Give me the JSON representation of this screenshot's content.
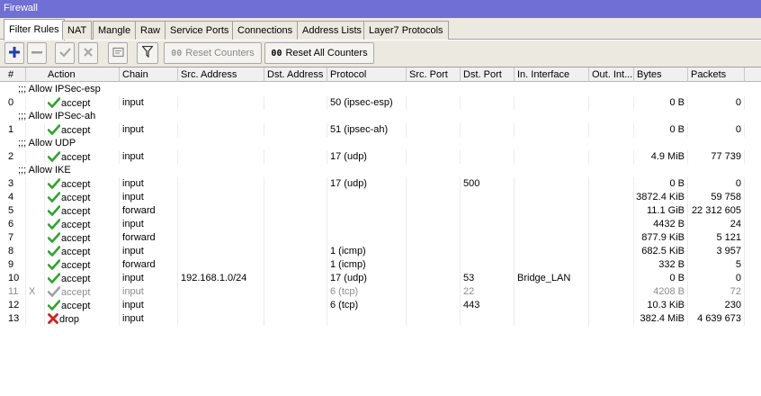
{
  "window": {
    "title": "Firewall"
  },
  "tabs": [
    "Filter Rules",
    "NAT",
    "Mangle",
    "Raw",
    "Service Ports",
    "Connections",
    "Address Lists",
    "Layer7 Protocols"
  ],
  "toolbar": {
    "reset_counters_icon": "00",
    "reset_counters": "Reset Counters",
    "reset_all_icon": "00",
    "reset_all": "Reset All Counters"
  },
  "columns": [
    "#",
    "Action",
    "Chain",
    "Src. Address",
    "Dst. Address",
    "Protocol",
    "Src. Port",
    "Dst. Port",
    "In. Interface",
    "Out. Int...",
    "Bytes",
    "Packets"
  ],
  "rows": [
    {
      "type": "comment",
      "text": ";;; Allow IPSec-esp"
    },
    {
      "type": "rule",
      "num": "0",
      "flag": "",
      "action": "accept",
      "icon": "check",
      "chain": "input",
      "src": "",
      "dst": "",
      "protocol": "50 (ipsec-esp)",
      "sport": "",
      "dport": "",
      "inif": "",
      "outif": "",
      "bytes": "0 B",
      "packets": "0"
    },
    {
      "type": "comment",
      "text": ";;; Allow IPSec-ah"
    },
    {
      "type": "rule",
      "num": "1",
      "flag": "",
      "action": "accept",
      "icon": "check",
      "chain": "input",
      "src": "",
      "dst": "",
      "protocol": "51 (ipsec-ah)",
      "sport": "",
      "dport": "",
      "inif": "",
      "outif": "",
      "bytes": "0 B",
      "packets": "0"
    },
    {
      "type": "comment",
      "text": ";;; Allow UDP"
    },
    {
      "type": "rule",
      "num": "2",
      "flag": "",
      "action": "accept",
      "icon": "check",
      "chain": "input",
      "src": "",
      "dst": "",
      "protocol": "17 (udp)",
      "sport": "",
      "dport": "",
      "inif": "",
      "outif": "",
      "bytes": "4.9 MiB",
      "packets": "77 739"
    },
    {
      "type": "comment",
      "text": ";;; Allow IKE"
    },
    {
      "type": "rule",
      "num": "3",
      "flag": "",
      "action": "accept",
      "icon": "check",
      "chain": "input",
      "src": "",
      "dst": "",
      "protocol": "17 (udp)",
      "sport": "",
      "dport": "500",
      "inif": "",
      "outif": "",
      "bytes": "0 B",
      "packets": "0"
    },
    {
      "type": "rule",
      "num": "4",
      "flag": "",
      "action": "accept",
      "icon": "check",
      "chain": "input",
      "src": "",
      "dst": "",
      "protocol": "",
      "sport": "",
      "dport": "",
      "inif": "",
      "outif": "",
      "bytes": "3872.4 KiB",
      "packets": "59 758"
    },
    {
      "type": "rule",
      "num": "5",
      "flag": "",
      "action": "accept",
      "icon": "check",
      "chain": "forward",
      "src": "",
      "dst": "",
      "protocol": "",
      "sport": "",
      "dport": "",
      "inif": "",
      "outif": "",
      "bytes": "11.1 GiB",
      "packets": "22 312 605"
    },
    {
      "type": "rule",
      "num": "6",
      "flag": "",
      "action": "accept",
      "icon": "check",
      "chain": "input",
      "src": "",
      "dst": "",
      "protocol": "",
      "sport": "",
      "dport": "",
      "inif": "",
      "outif": "",
      "bytes": "4432 B",
      "packets": "24"
    },
    {
      "type": "rule",
      "num": "7",
      "flag": "",
      "action": "accept",
      "icon": "check",
      "chain": "forward",
      "src": "",
      "dst": "",
      "protocol": "",
      "sport": "",
      "dport": "",
      "inif": "",
      "outif": "",
      "bytes": "877.9 KiB",
      "packets": "5 121"
    },
    {
      "type": "rule",
      "num": "8",
      "flag": "",
      "action": "accept",
      "icon": "check",
      "chain": "input",
      "src": "",
      "dst": "",
      "protocol": "1 (icmp)",
      "sport": "",
      "dport": "",
      "inif": "",
      "outif": "",
      "bytes": "682.5 KiB",
      "packets": "3 957"
    },
    {
      "type": "rule",
      "num": "9",
      "flag": "",
      "action": "accept",
      "icon": "check",
      "chain": "forward",
      "src": "",
      "dst": "",
      "protocol": "1 (icmp)",
      "sport": "",
      "dport": "",
      "inif": "",
      "outif": "",
      "bytes": "332 B",
      "packets": "5"
    },
    {
      "type": "rule",
      "num": "10",
      "flag": "",
      "action": "accept",
      "icon": "check",
      "chain": "input",
      "src": "192.168.1.0/24",
      "dst": "",
      "protocol": "17 (udp)",
      "sport": "",
      "dport": "53",
      "inif": "Bridge_LAN",
      "outif": "",
      "bytes": "0 B",
      "packets": "0"
    },
    {
      "type": "rule",
      "num": "11",
      "flag": "X",
      "disabled": true,
      "action": "accept",
      "icon": "check",
      "chain": "input",
      "src": "",
      "dst": "",
      "protocol": "6 (tcp)",
      "sport": "",
      "dport": "22",
      "inif": "",
      "outif": "",
      "bytes": "4208 B",
      "packets": "72"
    },
    {
      "type": "rule",
      "num": "12",
      "flag": "",
      "action": "accept",
      "icon": "check",
      "chain": "input",
      "src": "",
      "dst": "",
      "protocol": "6 (tcp)",
      "sport": "",
      "dport": "443",
      "inif": "",
      "outif": "",
      "bytes": "10.3 KiB",
      "packets": "230"
    },
    {
      "type": "rule",
      "num": "13",
      "flag": "",
      "action": "drop",
      "icon": "cross",
      "chain": "input",
      "src": "",
      "dst": "",
      "protocol": "",
      "sport": "",
      "dport": "",
      "inif": "",
      "outif": "",
      "bytes": "382.4 MiB",
      "packets": "4 639 673"
    }
  ],
  "colors": {
    "title_bar": "#6f6fd6",
    "accept": "#2da52d",
    "drop": "#d42020",
    "add": "#1e3fb0"
  }
}
